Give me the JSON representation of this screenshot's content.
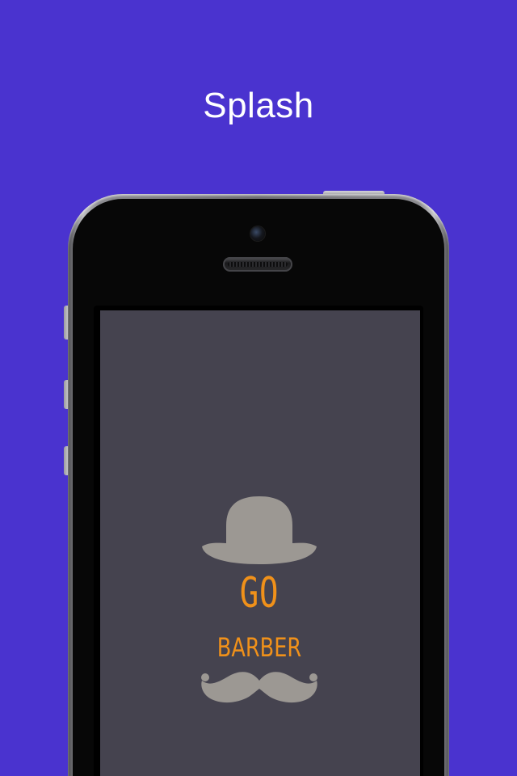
{
  "header": {
    "title": "Splash"
  },
  "splash": {
    "logo_line1": "GO",
    "logo_line2": "BARBER",
    "hat_icon": "bowler-hat-icon",
    "mustache_icon": "mustache-icon"
  },
  "colors": {
    "background": "#4a33cf",
    "screen": "#45434f",
    "logo_text": "#f0911a",
    "logo_graphic": "#9c9893"
  }
}
